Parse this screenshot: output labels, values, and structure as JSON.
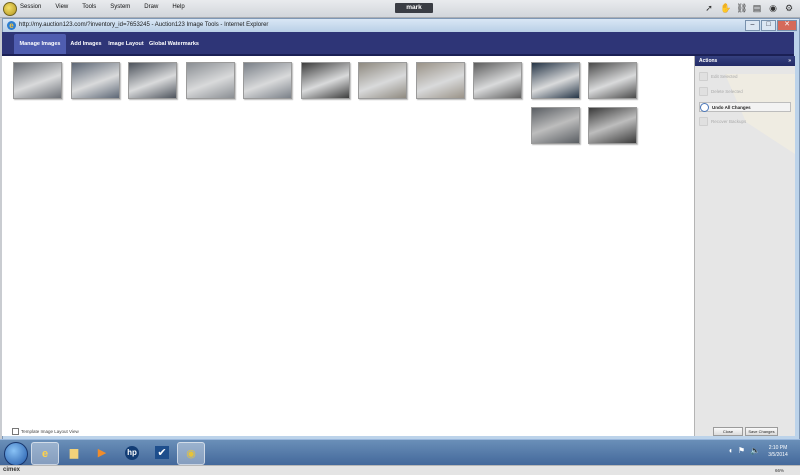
{
  "session": {
    "menu": [
      "Session",
      "View",
      "Tools",
      "System",
      "Draw",
      "Help"
    ],
    "title": "mark",
    "tool_icons": [
      "cursor-icon",
      "hand-icon",
      "link-icon",
      "folder-icon",
      "camera-icon",
      "gear-icon"
    ]
  },
  "window": {
    "title": "http://my.auction123.com/?inventory_id=7653245 - Auction123 Image Tools - Internet Explorer",
    "buttons": [
      "–",
      "□",
      "✕"
    ]
  },
  "tabs": [
    {
      "label": "Manage Images",
      "active": true
    },
    {
      "label": "Add Images",
      "active": false
    },
    {
      "label": "Image Layout",
      "active": false
    },
    {
      "label": "Global Watermarks",
      "active": false
    }
  ],
  "images": {
    "row1_colors": [
      "#6b6f76",
      "#5c6675",
      "#4d535c",
      "#8a8e93",
      "#7a8088",
      "#3d3d3d",
      "#8f8a80",
      "#9a9388",
      "#5d5d5d",
      "#243446",
      "#4a4a4a"
    ],
    "row2_colors": [
      "#5a5e63",
      "#3a3a3a"
    ]
  },
  "layout_view_label": "Template Image Layout View",
  "actions": {
    "title": "Actions",
    "items": [
      {
        "label": "Edit Selected",
        "enabled": false
      },
      {
        "label": "Delete Selected",
        "enabled": false
      },
      {
        "label": "Undo All Changes",
        "enabled": true
      },
      {
        "label": "Recover Backups",
        "enabled": false
      }
    ],
    "close_label": "Close",
    "save_label": "Save Changes"
  },
  "taskbar": {
    "apps": [
      "ie-icon",
      "folder-icon",
      "media-player-icon",
      "hp-icon",
      "checkmark-app-icon",
      "remote-session-icon"
    ],
    "clock_time": "2:10 PM",
    "clock_date": "3/5/2014"
  },
  "status": {
    "brand": "cimex",
    "zoom": "66%"
  }
}
